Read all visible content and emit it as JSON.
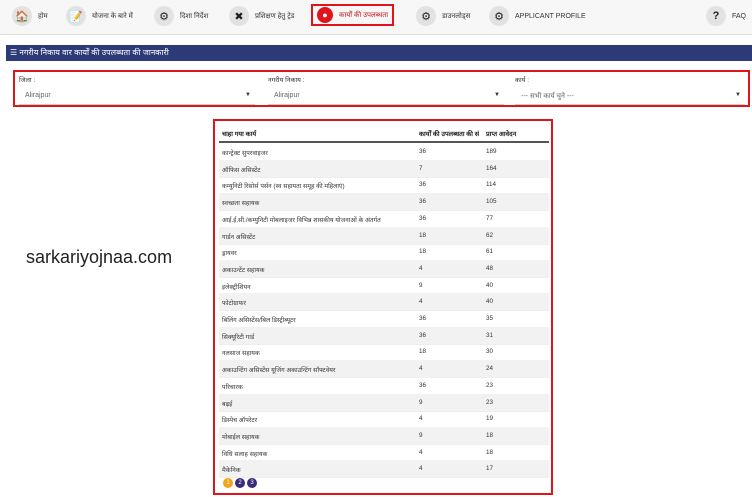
{
  "nav": {
    "items": [
      {
        "label": "होम",
        "icon": "home-icon",
        "glyph": "🏠"
      },
      {
        "label": "योजना के बारे में",
        "icon": "document-icon",
        "glyph": "📝"
      },
      {
        "label": "दिशा निर्देश",
        "icon": "gear-icon",
        "glyph": "⚙"
      },
      {
        "label": "प्रशिक्षण हेतु ट्रेड",
        "icon": "tools-icon",
        "glyph": "✖"
      },
      {
        "label": "कार्यों की उपलब्धता",
        "icon": "briefcase-icon",
        "glyph": "●"
      },
      {
        "label": "डाउनलोड्स",
        "icon": "gear-icon",
        "glyph": "⚙"
      },
      {
        "label": "APPLICANT PROFILE",
        "icon": "gear-icon",
        "glyph": "⚙"
      }
    ],
    "faq": {
      "label": "FAQ",
      "glyph": "?"
    }
  },
  "title": "नगरीय निकाय वार कार्यों की उपलब्धता की जानकारी",
  "filters": {
    "district": {
      "label": "जिला :",
      "value": "Alirajpur"
    },
    "body": {
      "label": "नगरीय निकाय :",
      "value": "Alirajpur"
    },
    "work": {
      "label": "कार्य :",
      "value": "--- सभी कार्य चुने ---"
    }
  },
  "watermark": "sarkariyojnaa.com",
  "table": {
    "headers": [
      "चाहा गया कार्य",
      "कार्यों की उपलब्धता की संख्या",
      "प्राप्त आवेदन"
    ],
    "rows": [
      [
        "कान्ट्रेक्ट सुपरवाइजर",
        "36",
        "189"
      ],
      [
        "ऑफिस असिस्टेंट",
        "7",
        "164"
      ],
      [
        "कम्युनिटी रिसोर्स पर्सन (स्व सहायता समूह की महिलाएं)",
        "36",
        "114"
      ],
      [
        "स्वच्छता सहायक",
        "36",
        "105"
      ],
      [
        "आई.ई.सी./कम्युनिटी मोबलाइजर विभिन्न शासकीय योजनाओं के अंतर्गत",
        "36",
        "77"
      ],
      [
        "गार्डन असिस्टेंट",
        "18",
        "62"
      ],
      [
        "ड्रायवर",
        "18",
        "61"
      ],
      [
        "अकाउन्टेंट सहायक",
        "4",
        "48"
      ],
      [
        "इलेक्ट्रीशियन",
        "9",
        "40"
      ],
      [
        "फोटोग्राफर",
        "4",
        "40"
      ],
      [
        "बिलिंग असिस्टेंस/बिल डिस्ट्रीब्यूटर",
        "36",
        "35"
      ],
      [
        "सिक्यूरिटी गार्ड",
        "36",
        "31"
      ],
      [
        "नलसाज सहायक",
        "18",
        "30"
      ],
      [
        "अकाउन्टिंग असिस्टेंस यूजिंग अकाउन्टिंग सॉफ्टवेयर",
        "4",
        "24"
      ],
      [
        "परिचारक",
        "36",
        "23"
      ],
      [
        "बढ़ई",
        "9",
        "23"
      ],
      [
        "डिस्पेच ऑपरेटर",
        "4",
        "19"
      ],
      [
        "मोबाईल सहायक",
        "9",
        "18"
      ],
      [
        "विधि सलाह सहायक",
        "4",
        "18"
      ],
      [
        "मैकेनिक",
        "4",
        "17"
      ]
    ]
  },
  "pager": [
    "1",
    "2",
    "3"
  ]
}
